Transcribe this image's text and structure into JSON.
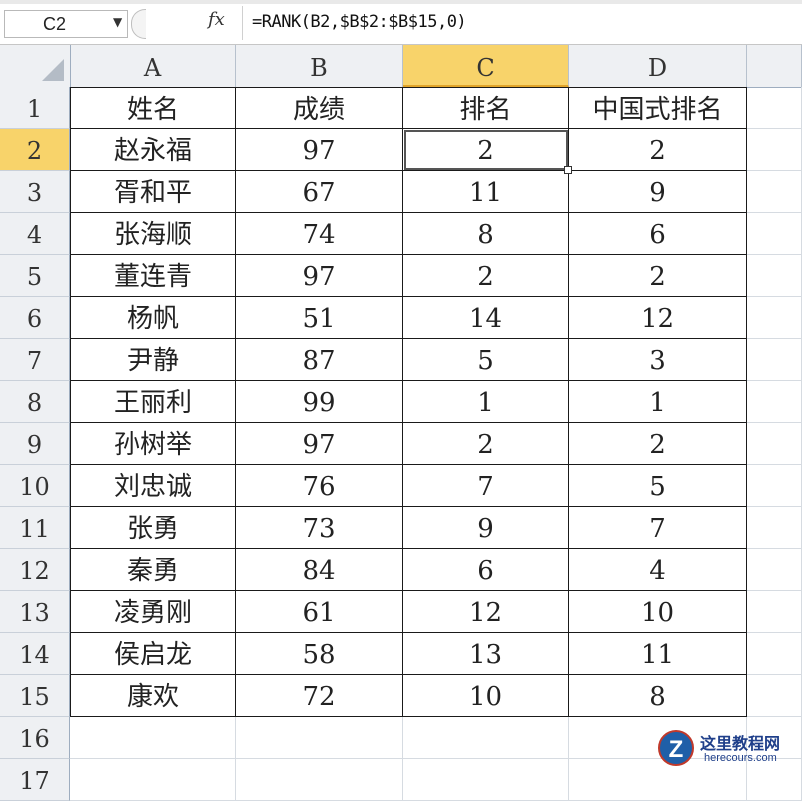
{
  "formula_bar": {
    "name_box": "C2",
    "fx_label": "fx",
    "formula": "=RANK(B2,$B$2:$B$15,0)"
  },
  "columns": [
    "A",
    "B",
    "C",
    "D"
  ],
  "active_column": "C",
  "active_row": "2",
  "row_numbers": [
    "1",
    "2",
    "3",
    "4",
    "5",
    "6",
    "7",
    "8",
    "9",
    "10",
    "11",
    "12",
    "13",
    "14",
    "15",
    "16",
    "17"
  ],
  "header_row": [
    "姓名",
    "成绩",
    "排名",
    "中国式排名"
  ],
  "rows": [
    [
      "赵永福",
      "97",
      "2",
      "2"
    ],
    [
      "胥和平",
      "67",
      "11",
      "9"
    ],
    [
      "张海顺",
      "74",
      "8",
      "6"
    ],
    [
      "董连青",
      "97",
      "2",
      "2"
    ],
    [
      "杨帆",
      "51",
      "14",
      "12"
    ],
    [
      "尹静",
      "87",
      "5",
      "3"
    ],
    [
      "王丽利",
      "99",
      "1",
      "1"
    ],
    [
      "孙树举",
      "97",
      "2",
      "2"
    ],
    [
      "刘忠诚",
      "76",
      "7",
      "5"
    ],
    [
      "张勇",
      "73",
      "9",
      "7"
    ],
    [
      "秦勇",
      "84",
      "6",
      "4"
    ],
    [
      "凌勇刚",
      "61",
      "12",
      "10"
    ],
    [
      "侯启龙",
      "58",
      "13",
      "11"
    ],
    [
      "康欢",
      "72",
      "10",
      "8"
    ]
  ],
  "watermark": {
    "logo": "Z",
    "title": "这里教程网",
    "url": "herecours.com"
  }
}
